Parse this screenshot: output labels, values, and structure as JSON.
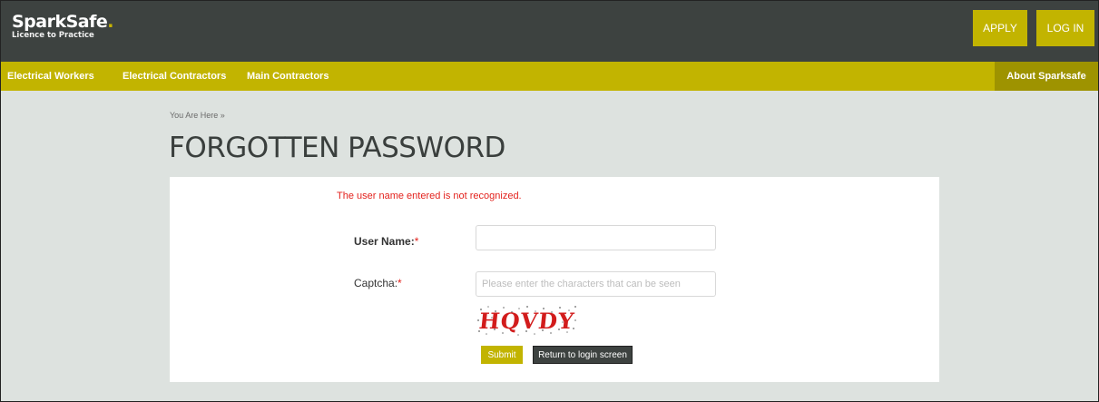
{
  "header": {
    "logo_text": "SparkSafe",
    "logo_dot": ".",
    "logo_tagline": "Licence to Practice",
    "apply_label": "APPLY",
    "login_label": "LOG IN"
  },
  "nav": {
    "items": [
      "Electrical Workers",
      "Electrical Contractors",
      "Main Contractors"
    ],
    "about_label": "About Sparksafe"
  },
  "breadcrumb": "You Are Here »",
  "page_title": "FORGOTTEN PASSWORD",
  "form": {
    "error_message": "The user name entered is not recognized.",
    "username_label": "User Name:",
    "username_value": "",
    "captcha_label": "Captcha:",
    "required_marker": "*",
    "captcha_placeholder": "Please enter the characters that can be seen",
    "captcha_text": "HQVDY",
    "submit_label": "Submit",
    "return_label": "Return to login screen"
  },
  "colors": {
    "topbar": "#3d4240",
    "accent": "#c2b400",
    "background": "#dde2df",
    "error": "#e3211c"
  }
}
